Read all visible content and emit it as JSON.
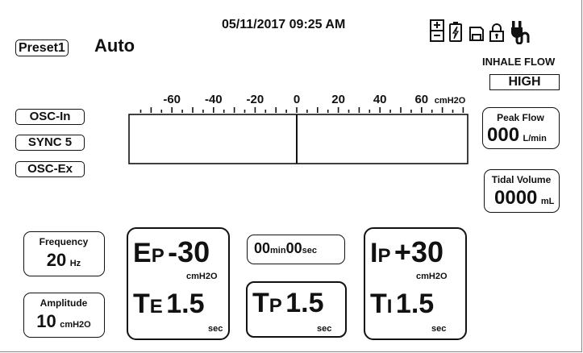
{
  "header": {
    "datetime": "05/11/2017 09:25 AM",
    "preset": "Preset1",
    "mode": "Auto",
    "status_icons": [
      "battery-level-icon",
      "battery-charging-icon",
      "save-icon",
      "lock-icon",
      "power-plug-icon"
    ]
  },
  "inhale_flow": {
    "label": "INHALE FLOW",
    "value": "HIGH"
  },
  "scale": {
    "ticks": [
      "-60",
      "-40",
      "-20",
      "0",
      "20",
      "40",
      "60"
    ],
    "unit": "cmH2O",
    "range": [
      -80,
      80
    ],
    "current_value": 0
  },
  "left_buttons": [
    "OSC-In",
    "SYNC 5",
    "OSC-Ex"
  ],
  "peak_flow": {
    "label": "Peak Flow",
    "value": "000",
    "unit": "L/min"
  },
  "tidal_volume": {
    "label": "Tidal Volume",
    "value": "0000",
    "unit": "mL"
  },
  "frequency": {
    "label": "Frequency",
    "value": "20",
    "unit": "Hz"
  },
  "amplitude": {
    "label": "Amplitude",
    "value": "10",
    "unit": "cmH2O"
  },
  "ep": {
    "label_big": "E",
    "label_small": "P",
    "value": "-30",
    "unit": "cmH2O"
  },
  "te": {
    "label_big": "T",
    "label_small": "E",
    "value": "1.5",
    "unit": "sec"
  },
  "timer": {
    "min_value": "00",
    "min_unit": "min",
    "sec_value": "00",
    "sec_unit": "sec"
  },
  "tp": {
    "label_big": "T",
    "label_small": "P",
    "value": "1.5",
    "unit": "sec"
  },
  "ip": {
    "label_big": "I",
    "label_small": "P",
    "value": "+30",
    "unit": "cmH2O"
  },
  "ti": {
    "label_big": "T",
    "label_small": "I",
    "value": "1.5",
    "unit": "sec"
  }
}
